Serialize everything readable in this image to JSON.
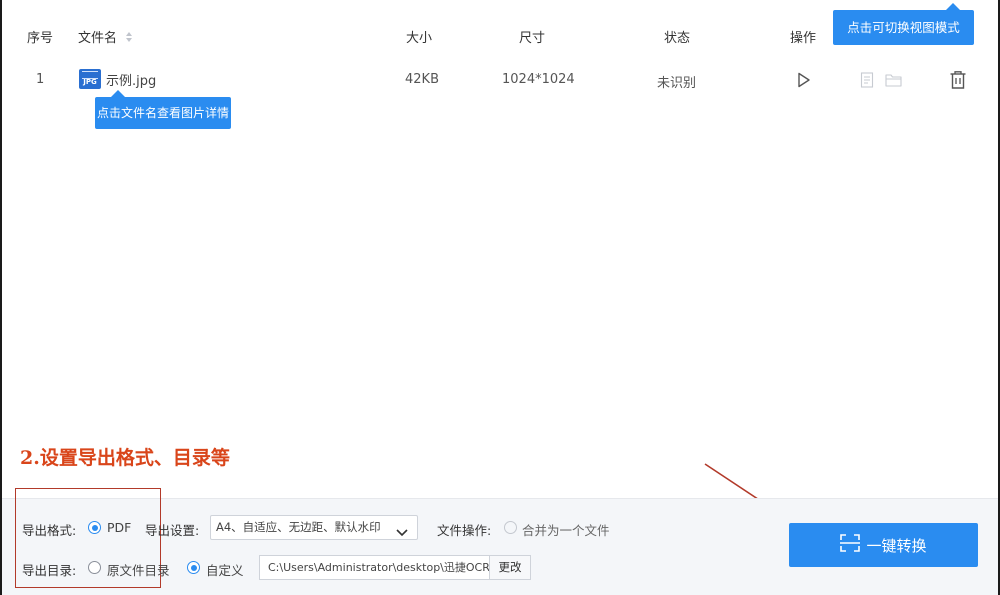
{
  "table": {
    "headers": {
      "seq": "序号",
      "name": "文件名",
      "size": "大小",
      "dims": "尺寸",
      "status": "状态",
      "ops": "操作"
    },
    "rows": [
      {
        "seq": "1",
        "file_icon": "JPG",
        "name": "示例.jpg",
        "size": "42KB",
        "dims": "1024*1024",
        "status": "未识别"
      }
    ]
  },
  "tooltips": {
    "view_mode": "点击可切换视图模式",
    "file_name": "点击文件名查看图片详情"
  },
  "annotation": {
    "text": "2.设置导出格式、目录等",
    "color": "#d9451a"
  },
  "export": {
    "format_label": "导出格式:",
    "format_option": "PDF",
    "settings_label": "导出设置:",
    "settings_value": "A4、自适应、无边距、默认水印",
    "file_ops_label": "文件操作:",
    "merge_option": "合并为一个文件",
    "dir_label": "导出目录:",
    "dir_option_original": "原文件目录",
    "dir_option_custom": "自定义",
    "dir_path": "C:\\Users\\Administrator\\desktop\\迅捷OCR文",
    "change_button": "更改",
    "convert_button": "一键转换"
  },
  "colors": {
    "accent": "#2a8cf0",
    "annotation_box": "#b23a2a"
  }
}
